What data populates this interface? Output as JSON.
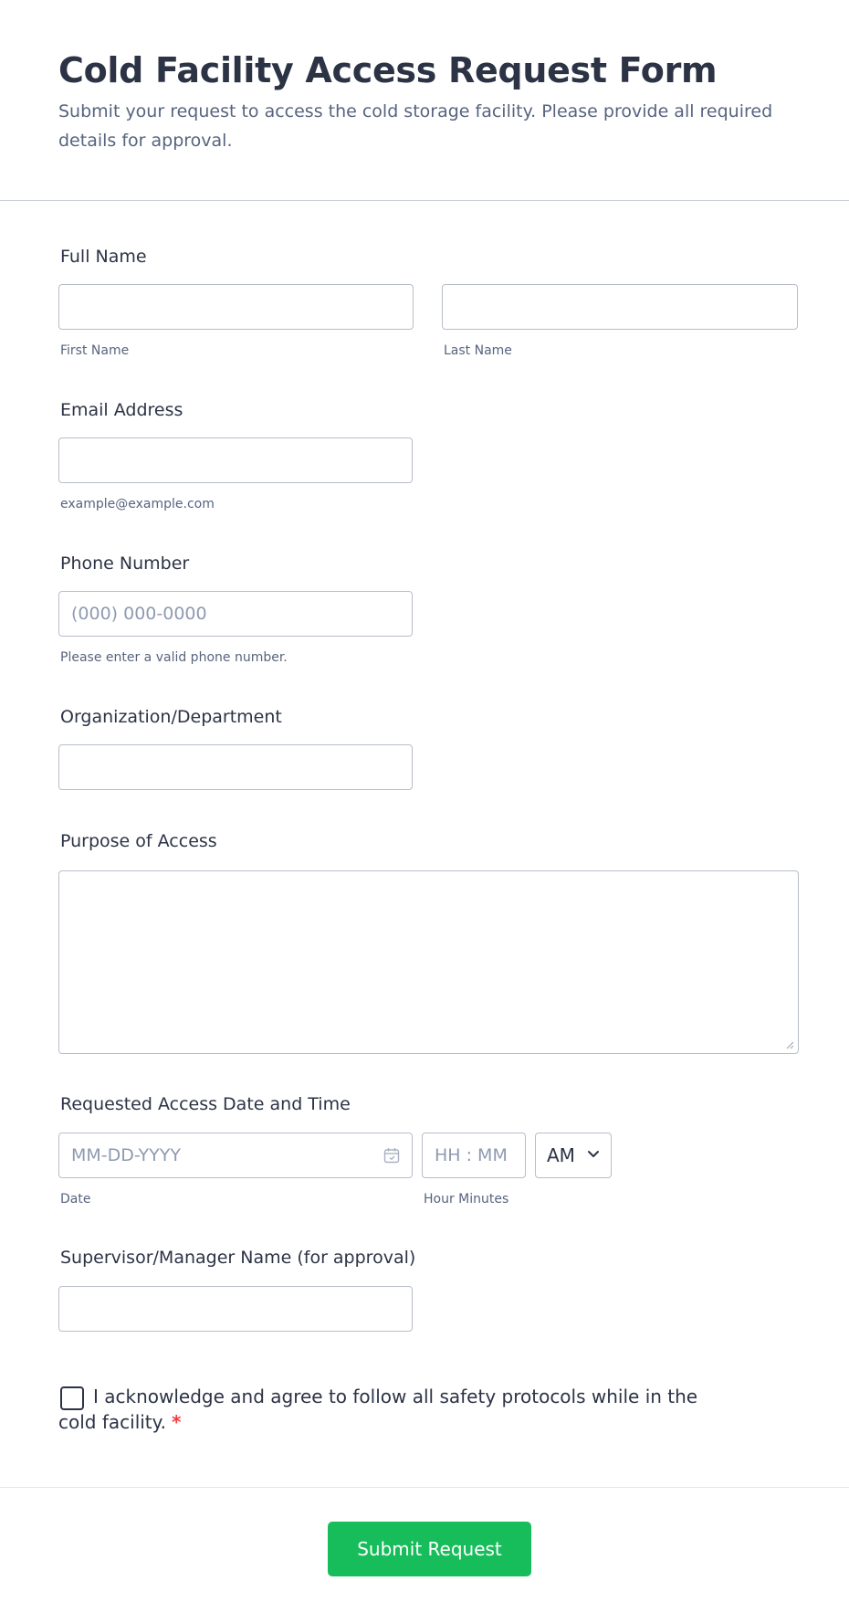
{
  "form": {
    "title": "Cold Facility Access Request Form",
    "subtitle": "Submit your request to access the cold storage facility. Please provide all required details for approval."
  },
  "full_name": {
    "label": "Full Name",
    "first_sublabel": "First Name",
    "last_sublabel": "Last Name",
    "first_value": "",
    "last_value": ""
  },
  "email": {
    "label": "Email Address",
    "sublabel": "example@example.com",
    "value": ""
  },
  "phone": {
    "label": "Phone Number",
    "placeholder": "(000) 000-0000",
    "sublabel": "Please enter a valid phone number.",
    "value": ""
  },
  "organization": {
    "label": "Organization/Department",
    "value": ""
  },
  "purpose": {
    "label": "Purpose of Access",
    "value": ""
  },
  "access_datetime": {
    "label": "Requested Access Date and Time",
    "date_placeholder": "MM-DD-YYYY",
    "time_placeholder": "HH : MM",
    "ampm_value": "AM",
    "date_sublabel": "Date",
    "time_sublabel": "Hour Minutes",
    "calendar_icon": "calendar-icon",
    "dropdown_icon": "chevron-down-icon"
  },
  "supervisor": {
    "label": "Supervisor/Manager Name (for approval)",
    "value": ""
  },
  "acknowledgement": {
    "text": "I acknowledge and agree to follow all safety protocols while in the cold facility.",
    "required_mark": "*",
    "checked": false
  },
  "submit": {
    "label": "Submit Request"
  },
  "colors": {
    "submit_bg": "#18bd5b",
    "required": "#f23a3c",
    "text": "#2c3345",
    "muted": "#57647e"
  }
}
